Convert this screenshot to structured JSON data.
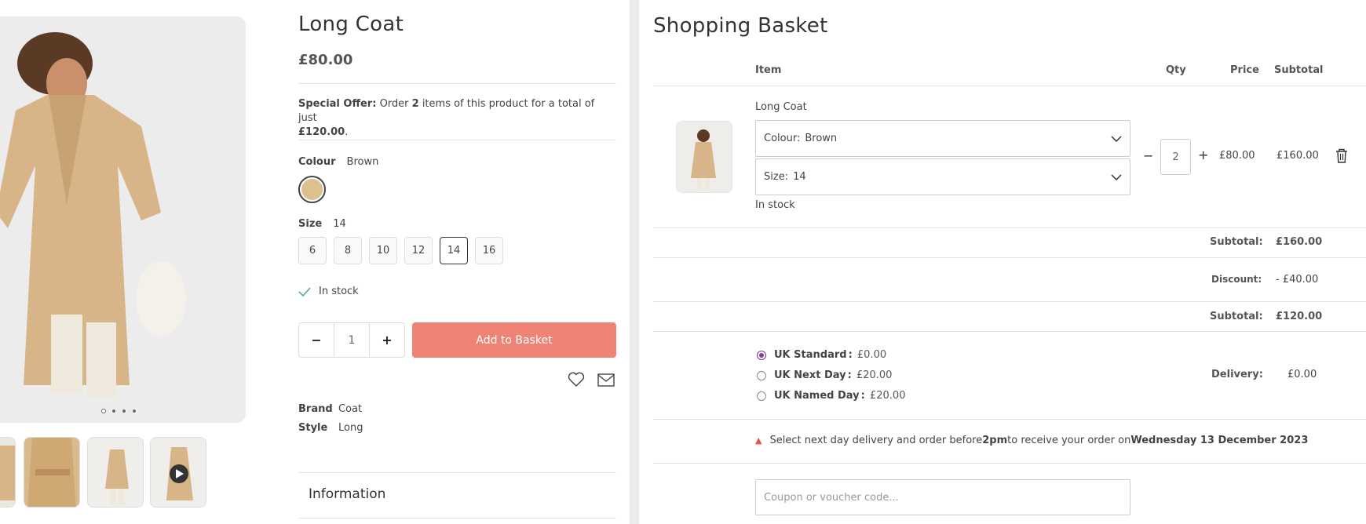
{
  "product": {
    "title": "Long Coat",
    "price": "£80.00",
    "offer_label": "Special Offer:",
    "offer_text_1": "Order ",
    "offer_qty": "2",
    "offer_text_2": " items of this product for a total of just",
    "offer_total": "£120.00",
    "offer_end": ".",
    "colour_label": "Colour",
    "colour_value": "Brown",
    "swatch_color": "#dcc08f",
    "size_label": "Size",
    "size_value": "14",
    "sizes": [
      "6",
      "8",
      "10",
      "12",
      "14",
      "16"
    ],
    "selected_size": "14",
    "stock": "In stock",
    "quantity": "1",
    "minus": "−",
    "plus": "+",
    "add_to_basket": "Add to Basket",
    "brand_label": "Brand",
    "brand_value": "Coat",
    "style_label": "Style",
    "style_value": "Long",
    "information": "Information",
    "accent_color": "#ef8375"
  },
  "basket": {
    "title": "Shopping Basket",
    "headers": {
      "item": "Item",
      "qty": "Qty",
      "price": "Price",
      "subtotal": "Subtotal"
    },
    "item": {
      "name": "Long Coat",
      "colour_label": "Colour:",
      "colour_value": "Brown",
      "size_label": "Size:",
      "size_value": "14",
      "stock": "In stock",
      "qty_minus": "−",
      "qty": "2",
      "qty_plus": "+",
      "price": "£80.00",
      "subtotal": "£160.00"
    },
    "totals": {
      "subtotal_label": "Subtotal:",
      "subtotal_value": "£160.00",
      "discount_label": "Discount:",
      "discount_value": "- £40.00",
      "subtotal2_label": "Subtotal:",
      "subtotal2_value": "£120.00"
    },
    "delivery": {
      "options": [
        {
          "name": "UK Standard",
          "price": "£0.00",
          "selected": true
        },
        {
          "name": "UK Next Day",
          "price": "£20.00",
          "selected": false
        },
        {
          "name": "UK Named Day",
          "price": "£20.00",
          "selected": false
        }
      ],
      "label": "Delivery:",
      "value": "£0.00"
    },
    "notice": {
      "text_1": "Select next day delivery and order before ",
      "time": "2pm",
      "text_2": " to receive your order on ",
      "date": "Wednesday 13 December 2023"
    },
    "coupon_placeholder": "Coupon or voucher code..."
  }
}
